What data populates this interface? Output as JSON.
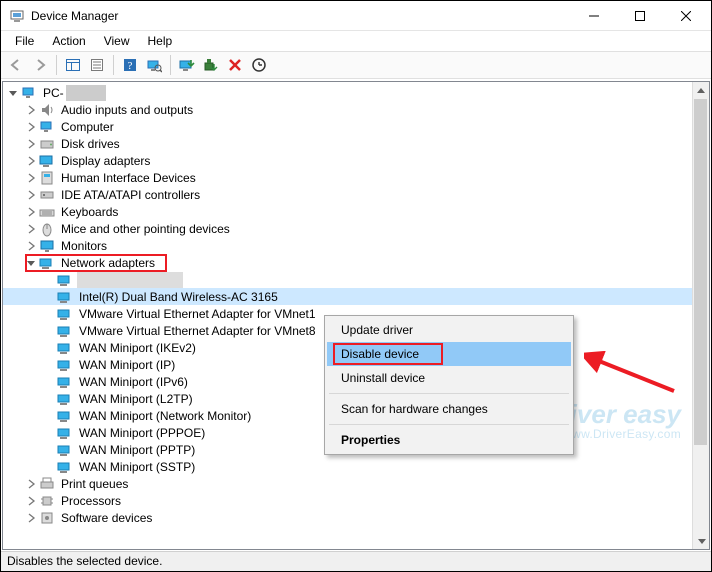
{
  "window": {
    "title": "Device Manager"
  },
  "menubar": [
    "File",
    "Action",
    "View",
    "Help"
  ],
  "tree": {
    "root": "PC-",
    "categories": [
      "Audio inputs and outputs",
      "Computer",
      "Disk drives",
      "Display adapters",
      "Human Interface Devices",
      "IDE ATA/ATAPI controllers",
      "Keyboards",
      "Mice and other pointing devices",
      "Monitors"
    ],
    "network_label": "Network adapters",
    "network_children": [
      "",
      "Intel(R) Dual Band Wireless-AC 3165",
      "VMware Virtual Ethernet Adapter for VMnet1",
      "VMware Virtual Ethernet Adapter for VMnet8",
      "WAN Miniport (IKEv2)",
      "WAN Miniport (IP)",
      "WAN Miniport (IPv6)",
      "WAN Miniport (L2TP)",
      "WAN Miniport (Network Monitor)",
      "WAN Miniport (PPPOE)",
      "WAN Miniport (PPTP)",
      "WAN Miniport (SSTP)"
    ],
    "after": [
      "Print queues",
      "Processors",
      "Software devices"
    ]
  },
  "context_menu": {
    "update": "Update driver",
    "disable": "Disable device",
    "uninstall": "Uninstall device",
    "scan": "Scan for hardware changes",
    "properties": "Properties"
  },
  "statusbar": "Disables the selected device.",
  "watermark": {
    "brand": "driver easy",
    "url": "www.DriverEasy.com"
  }
}
